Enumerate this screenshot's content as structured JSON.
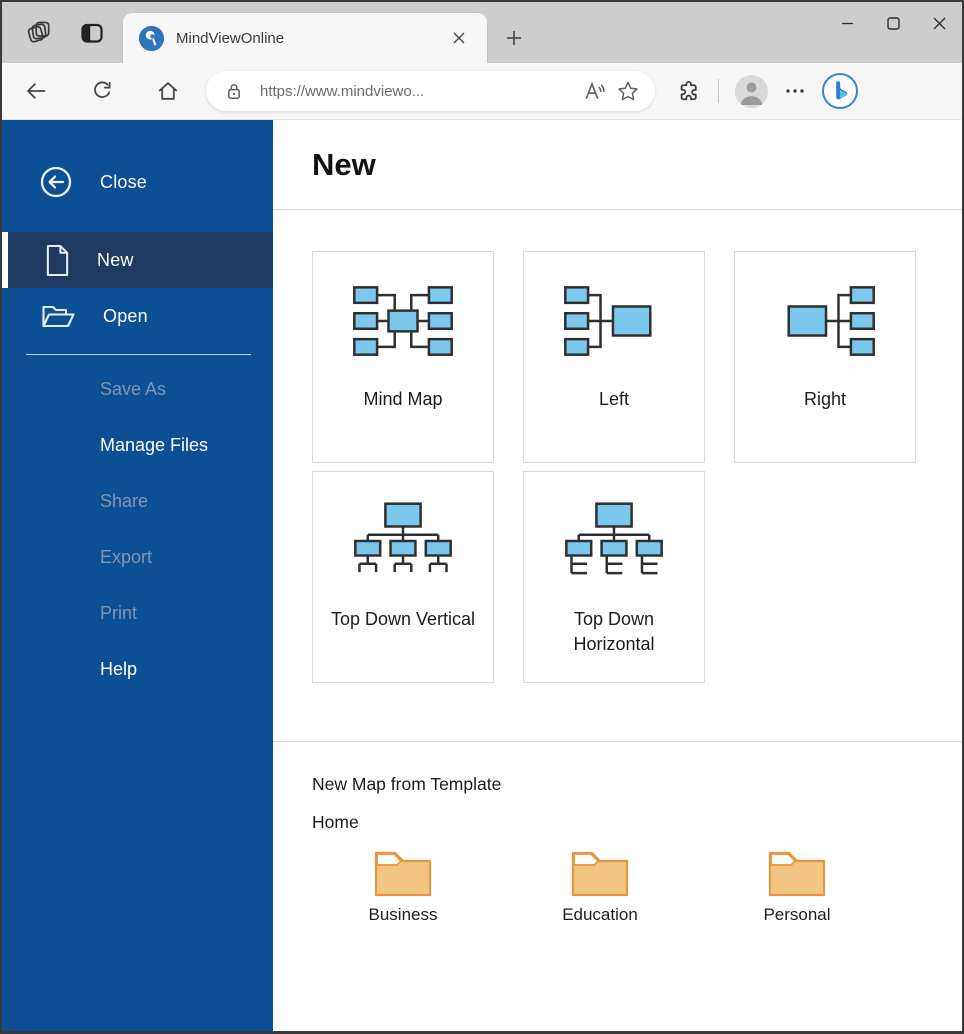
{
  "browser": {
    "tab": {
      "title": "MindViewOnline",
      "favicon": "mindview-logo-icon"
    },
    "address": {
      "url": "https://www.mindviewo...",
      "lock_icon": "lock-icon",
      "read_aloud_icon": "read-aloud-icon",
      "favorite_icon": "star-icon"
    },
    "toolbar_icons": [
      "back-icon",
      "refresh-icon",
      "home-icon",
      "extensions-icon",
      "profile-avatar",
      "more-icon",
      "bing-chat-icon"
    ],
    "tabstrip_icons": [
      "workspaces-icon",
      "tab-actions-icon",
      "tab-close-icon",
      "new-tab-icon"
    ],
    "window_controls": [
      "minimize-icon",
      "maximize-icon",
      "close-icon"
    ]
  },
  "sidebar": {
    "items": [
      {
        "label": "Close",
        "icon": "back-circle-icon",
        "state": "normal"
      },
      {
        "label": "New",
        "icon": "document-icon",
        "state": "active"
      },
      {
        "label": "Open",
        "icon": "open-folder-icon",
        "state": "normal"
      },
      {
        "label": "Save As",
        "state": "disabled"
      },
      {
        "label": "Manage Files",
        "state": "normal"
      },
      {
        "label": "Share",
        "state": "disabled"
      },
      {
        "label": "Export",
        "state": "disabled"
      },
      {
        "label": "Print",
        "state": "disabled"
      },
      {
        "label": "Help",
        "state": "normal"
      }
    ]
  },
  "main": {
    "heading": "New",
    "cards": [
      {
        "label": "Mind Map",
        "icon": "mindmap-layout-icon"
      },
      {
        "label": "Left",
        "icon": "left-layout-icon"
      },
      {
        "label": "Right",
        "icon": "right-layout-icon"
      },
      {
        "label": "Top Down Vertical",
        "icon": "top-down-vertical-layout-icon"
      },
      {
        "label": "Top Down Horizontal",
        "icon": "top-down-horizontal-layout-icon"
      }
    ],
    "templates": {
      "title": "New Map from Template",
      "breadcrumb": "Home",
      "folders": [
        {
          "label": "Business",
          "icon": "folder-icon"
        },
        {
          "label": "Education",
          "icon": "folder-icon"
        },
        {
          "label": "Personal",
          "icon": "folder-icon"
        }
      ]
    }
  },
  "colors": {
    "sidebar_blue": "#0d4f94",
    "sidebar_active": "#1f3a60",
    "disabled_text": "#8095b6",
    "layout_box_fill": "#7cc7ec",
    "layout_box_stroke": "#2f2f2f",
    "folder_fill": "#f2c583",
    "folder_stroke": "#e9953e",
    "tabstrip_bg": "#cdcdcd",
    "toolbar_bg": "#f7f7f7"
  }
}
